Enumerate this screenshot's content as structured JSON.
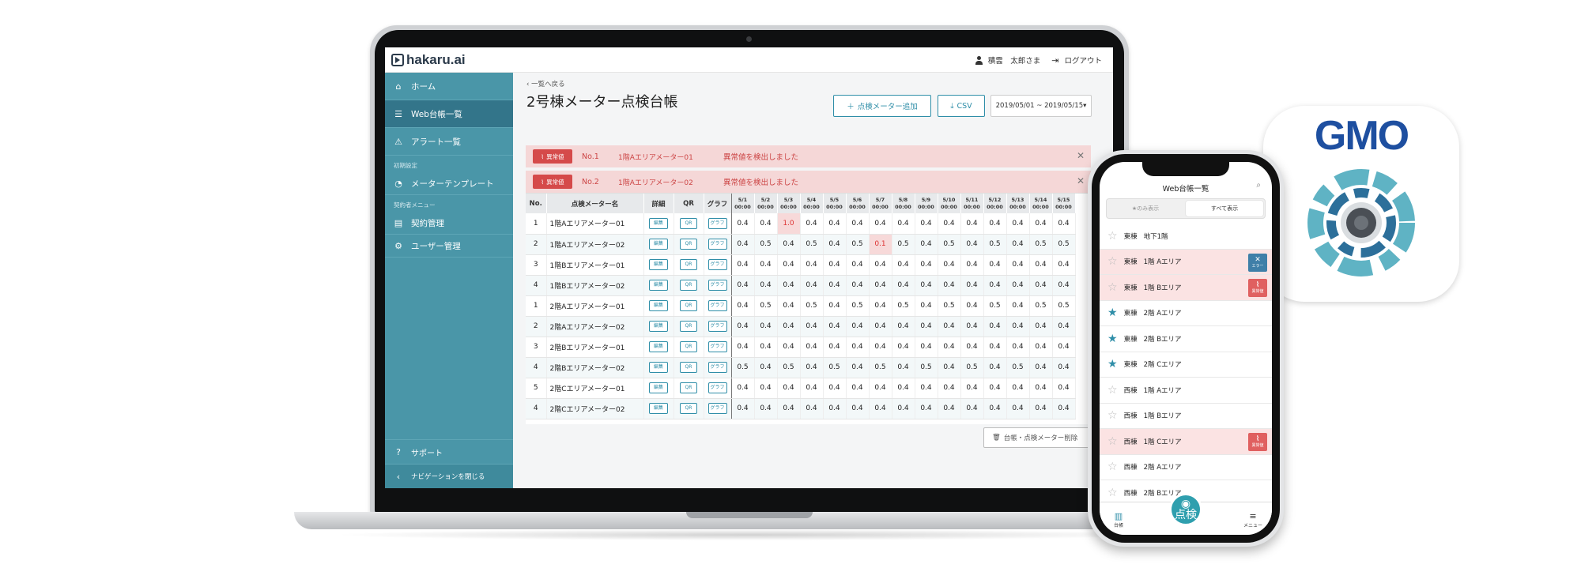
{
  "app": {
    "logo": "hakaru.ai",
    "user": "積雲　太郎さま",
    "logout": "ログアウト"
  },
  "sidebar": {
    "items": [
      {
        "label": "ホーム",
        "icon": "home-icon"
      },
      {
        "label": "Web台帳一覧",
        "icon": "list-icon"
      },
      {
        "label": "アラート一覧",
        "icon": "warning-icon"
      }
    ],
    "section_initial": "初期設定",
    "item_template": "メーターテンプレート",
    "section_contract": "契約者メニュー",
    "item_contract": "契約管理",
    "item_users": "ユーザー管理",
    "support": "サポート",
    "close_nav": "ナビゲーションを閉じる"
  },
  "main": {
    "back": "‹ 一覧へ戻る",
    "title": "2号棟メーター点検台帳",
    "add_button": "点検メーター追加",
    "csv_button": "CSV",
    "date_range": "2019/05/01 ~ 2019/05/15",
    "alerts": [
      {
        "tag": "異常値",
        "no": "No.1",
        "area": "1階Aエリアメーター01",
        "msg": "異常値を検出しました"
      },
      {
        "tag": "異常値",
        "no": "No.2",
        "area": "1階Aエリアメーター02",
        "msg": "異常値を検出しました"
      }
    ],
    "delete_button": "台帳・点検メーター削除"
  },
  "table": {
    "headers": {
      "no": "No.",
      "name": "点検メーター名",
      "detail": "詳細",
      "qr": "QR",
      "graph": "グラフ"
    },
    "dates": [
      "5/1",
      "5/2",
      "5/3",
      "5/4",
      "5/5",
      "5/6",
      "5/7",
      "5/8",
      "5/9",
      "5/10",
      "5/11",
      "5/12",
      "5/13",
      "5/14",
      "5/15"
    ],
    "time": "00:00",
    "btn_edit": "編集",
    "btn_qr": "QR",
    "btn_graph": "グラフ",
    "rows": [
      {
        "no": "1",
        "name": "1階Aエリアメーター01",
        "vals": [
          "0.4",
          "0.4",
          "1.0",
          "0.4",
          "0.4",
          "0.4",
          "0.4",
          "0.4",
          "0.4",
          "0.4",
          "0.4",
          "0.4",
          "0.4",
          "0.4",
          "0.4"
        ],
        "hi": 2
      },
      {
        "no": "2",
        "name": "1階Aエリアメーター02",
        "vals": [
          "0.4",
          "0.5",
          "0.4",
          "0.5",
          "0.4",
          "0.5",
          "0.1",
          "0.5",
          "0.4",
          "0.5",
          "0.4",
          "0.5",
          "0.4",
          "0.5",
          "0.5"
        ],
        "hi": 6
      },
      {
        "no": "3",
        "name": "1階Bエリアメーター01",
        "vals": [
          "0.4",
          "0.4",
          "0.4",
          "0.4",
          "0.4",
          "0.4",
          "0.4",
          "0.4",
          "0.4",
          "0.4",
          "0.4",
          "0.4",
          "0.4",
          "0.4",
          "0.4"
        ],
        "hi": -1
      },
      {
        "no": "4",
        "name": "1階Bエリアメーター02",
        "vals": [
          "0.4",
          "0.4",
          "0.4",
          "0.4",
          "0.4",
          "0.4",
          "0.4",
          "0.4",
          "0.4",
          "0.4",
          "0.4",
          "0.4",
          "0.4",
          "0.4",
          "0.4"
        ],
        "hi": -1
      },
      {
        "no": "1",
        "name": "2階Aエリアメーター01",
        "vals": [
          "0.4",
          "0.5",
          "0.4",
          "0.5",
          "0.4",
          "0.5",
          "0.4",
          "0.5",
          "0.4",
          "0.5",
          "0.4",
          "0.5",
          "0.4",
          "0.5",
          "0.5"
        ],
        "hi": -1
      },
      {
        "no": "2",
        "name": "2階Aエリアメーター02",
        "vals": [
          "0.4",
          "0.4",
          "0.4",
          "0.4",
          "0.4",
          "0.4",
          "0.4",
          "0.4",
          "0.4",
          "0.4",
          "0.4",
          "0.4",
          "0.4",
          "0.4",
          "0.4"
        ],
        "hi": -1
      },
      {
        "no": "3",
        "name": "2階Bエリアメーター01",
        "vals": [
          "0.4",
          "0.4",
          "0.4",
          "0.4",
          "0.4",
          "0.4",
          "0.4",
          "0.4",
          "0.4",
          "0.4",
          "0.4",
          "0.4",
          "0.4",
          "0.4",
          "0.4"
        ],
        "hi": -1
      },
      {
        "no": "4",
        "name": "2階Bエリアメーター02",
        "vals": [
          "0.5",
          "0.4",
          "0.5",
          "0.4",
          "0.5",
          "0.4",
          "0.5",
          "0.4",
          "0.5",
          "0.4",
          "0.5",
          "0.4",
          "0.5",
          "0.4",
          "0.4"
        ],
        "hi": -1
      },
      {
        "no": "5",
        "name": "2階Cエリアメーター01",
        "vals": [
          "0.4",
          "0.4",
          "0.4",
          "0.4",
          "0.4",
          "0.4",
          "0.4",
          "0.4",
          "0.4",
          "0.4",
          "0.4",
          "0.4",
          "0.4",
          "0.4",
          "0.4"
        ],
        "hi": -1
      },
      {
        "no": "4",
        "name": "2階Cエリアメーター02",
        "vals": [
          "0.4",
          "0.4",
          "0.4",
          "0.4",
          "0.4",
          "0.4",
          "0.4",
          "0.4",
          "0.4",
          "0.4",
          "0.4",
          "0.4",
          "0.4",
          "0.4",
          "0.4"
        ],
        "hi": -1
      }
    ]
  },
  "phone": {
    "title": "Web台帳一覧",
    "seg_left": "★のみ表示",
    "seg_right": "すべて表示",
    "rows": [
      {
        "building": "東棟",
        "area": "地下1階",
        "star": false,
        "err": false,
        "badge": null
      },
      {
        "building": "東棟",
        "area": "1階 Aエリア",
        "star": false,
        "err": true,
        "badge": "エラー"
      },
      {
        "building": "東棟",
        "area": "1階 Bエリア",
        "star": false,
        "err": true,
        "badge": "異常値"
      },
      {
        "building": "東棟",
        "area": "2階 Aエリア",
        "star": true,
        "err": false,
        "badge": null
      },
      {
        "building": "東棟",
        "area": "2階 Bエリア",
        "star": true,
        "err": false,
        "badge": null
      },
      {
        "building": "東棟",
        "area": "2階 Cエリア",
        "star": true,
        "err": false,
        "badge": null
      },
      {
        "building": "西棟",
        "area": "1階 Aエリア",
        "star": false,
        "err": false,
        "badge": null
      },
      {
        "building": "西棟",
        "area": "1階 Bエリア",
        "star": false,
        "err": false,
        "badge": null
      },
      {
        "building": "西棟",
        "area": "1階 Cエリア",
        "star": false,
        "err": true,
        "badge": "異常値"
      },
      {
        "building": "西棟",
        "area": "2階 Aエリア",
        "star": false,
        "err": false,
        "badge": null
      },
      {
        "building": "西棟",
        "area": "2階 Bエリア",
        "star": false,
        "err": false,
        "badge": null
      }
    ],
    "tabs": {
      "ledger": "台帳",
      "inspect": "点検",
      "menu": "メニュー"
    }
  },
  "gmo": {
    "logo": "GMO"
  },
  "colors": {
    "teal": "#4a96a8",
    "active": "#33758a",
    "accent": "#2f8ea8",
    "alert": "#d54a4a",
    "gmo_blue": "#1e4fa0"
  }
}
